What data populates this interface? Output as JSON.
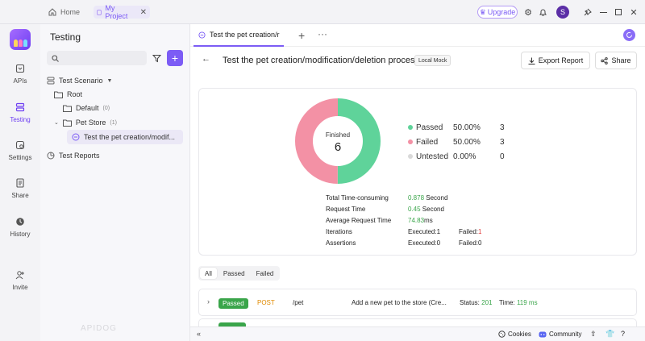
{
  "titlebar": {
    "home_tab": "Home",
    "project_tab": "My Project",
    "upgrade_label": "Upgrade",
    "avatar_initial": "S"
  },
  "rail": {
    "items": [
      {
        "label": "APIs",
        "icon": "api-icon"
      },
      {
        "label": "Testing",
        "icon": "testing-icon"
      },
      {
        "label": "Settings",
        "icon": "settings-icon"
      },
      {
        "label": "Share",
        "icon": "share-doc-icon"
      },
      {
        "label": "History",
        "icon": "history-icon"
      },
      {
        "label": "Invite",
        "icon": "invite-icon"
      }
    ],
    "watermark": "APIDOG"
  },
  "side": {
    "title": "Testing",
    "search_placeholder": "",
    "tree": {
      "scenario_label": "Test Scenario",
      "root_label": "Root",
      "default_label": "Default",
      "default_count": "(0)",
      "petstore_label": "Pet Store",
      "petstore_count": "(1)",
      "case_label": "Test the pet creation/modif...",
      "reports_label": "Test Reports"
    }
  },
  "main": {
    "tab_label": "Test the pet creation/r",
    "title": "Test the pet creation/modification/deletion process",
    "env_badge": "Local Mock",
    "export_label": "Export Report",
    "share_label": "Share",
    "summary": {
      "center_label": "Finished",
      "center_value": "6",
      "legend": [
        {
          "label": "Passed",
          "pct": "50.00%",
          "count": "3",
          "color": "#5fd39a"
        },
        {
          "label": "Failed",
          "pct": "50.00%",
          "count": "3",
          "color": "#f391a5"
        },
        {
          "label": "Untested",
          "pct": "0.00%",
          "count": "0",
          "color": "#d9d9d9"
        }
      ],
      "stats": {
        "total_label": "Total Time-consuming",
        "total_value": "0.878",
        "total_unit": " Second",
        "req_label": "Request Time",
        "req_value": "0.45",
        "req_unit": " Second",
        "avg_label": "Average Request Time",
        "avg_value": "74.83",
        "avg_unit": "ms",
        "iter_label": "Iterations",
        "iter_exec": "Executed:1",
        "iter_failed_label": "Failed:",
        "iter_failed_value": "1",
        "assert_label": "Assertions",
        "assert_exec": "Executed:0",
        "assert_failed": "Failed:0"
      }
    },
    "filters": [
      "All",
      "Passed",
      "Failed"
    ],
    "results": [
      {
        "status": "Passed",
        "method": "POST",
        "path": "/pet",
        "desc": "Add a new pet to the store (Cre...",
        "status_label": "Status:",
        "status_code": "201",
        "time_label": "Time:",
        "time_value": "119 ms"
      }
    ]
  },
  "statusbar": {
    "cookies_label": "Cookies",
    "community_label": "Community"
  }
}
